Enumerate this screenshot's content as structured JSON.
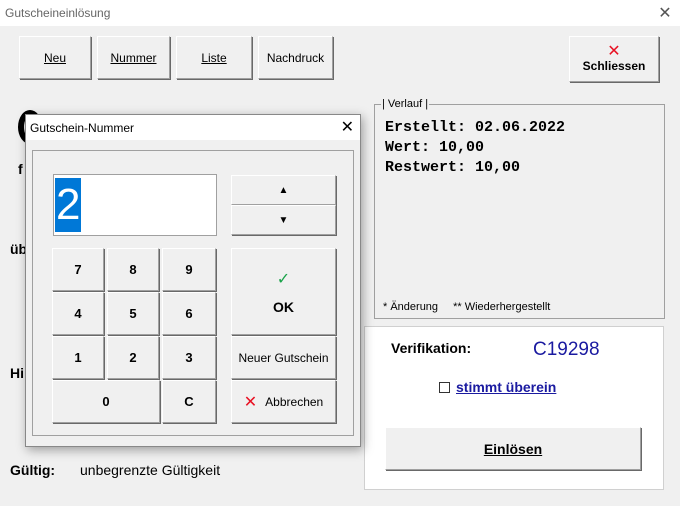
{
  "window": {
    "title": "Gutscheineinlösung"
  },
  "toolbar": {
    "neu": "Neu",
    "nummer": "Nummer",
    "liste": "Liste",
    "nachdruck": "Nachdruck",
    "schliessen": "Schliessen"
  },
  "fragments": {
    "f": "f",
    "ub": "üb",
    "hi": "Hi"
  },
  "verlauf": {
    "legend": "Verlauf",
    "text": "Erstellt: 02.06.2022\nWert: 10,00\nRestwert: 10,00",
    "footnote1": "* Änderung",
    "footnote2": "** Wiederhergestellt"
  },
  "verification": {
    "label": "Verifikation:",
    "code": "C19298",
    "checkbox_label": "stimmt überein",
    "checked": false,
    "einloesen_label": "Einlösen"
  },
  "validity": {
    "label": "Gültig:",
    "value": "unbegrenzte Gültigkeit"
  },
  "dialog": {
    "title": "Gutschein-Nummer",
    "display_value": "2",
    "keys": [
      "7",
      "8",
      "9",
      "4",
      "5",
      "6",
      "1",
      "2",
      "3",
      "0",
      "C"
    ],
    "up_arrow": "▲",
    "down_arrow": "▼",
    "ok_label": "OK",
    "new_voucher_label": "Neuer Gutschein",
    "cancel_label": "Abbrechen"
  }
}
